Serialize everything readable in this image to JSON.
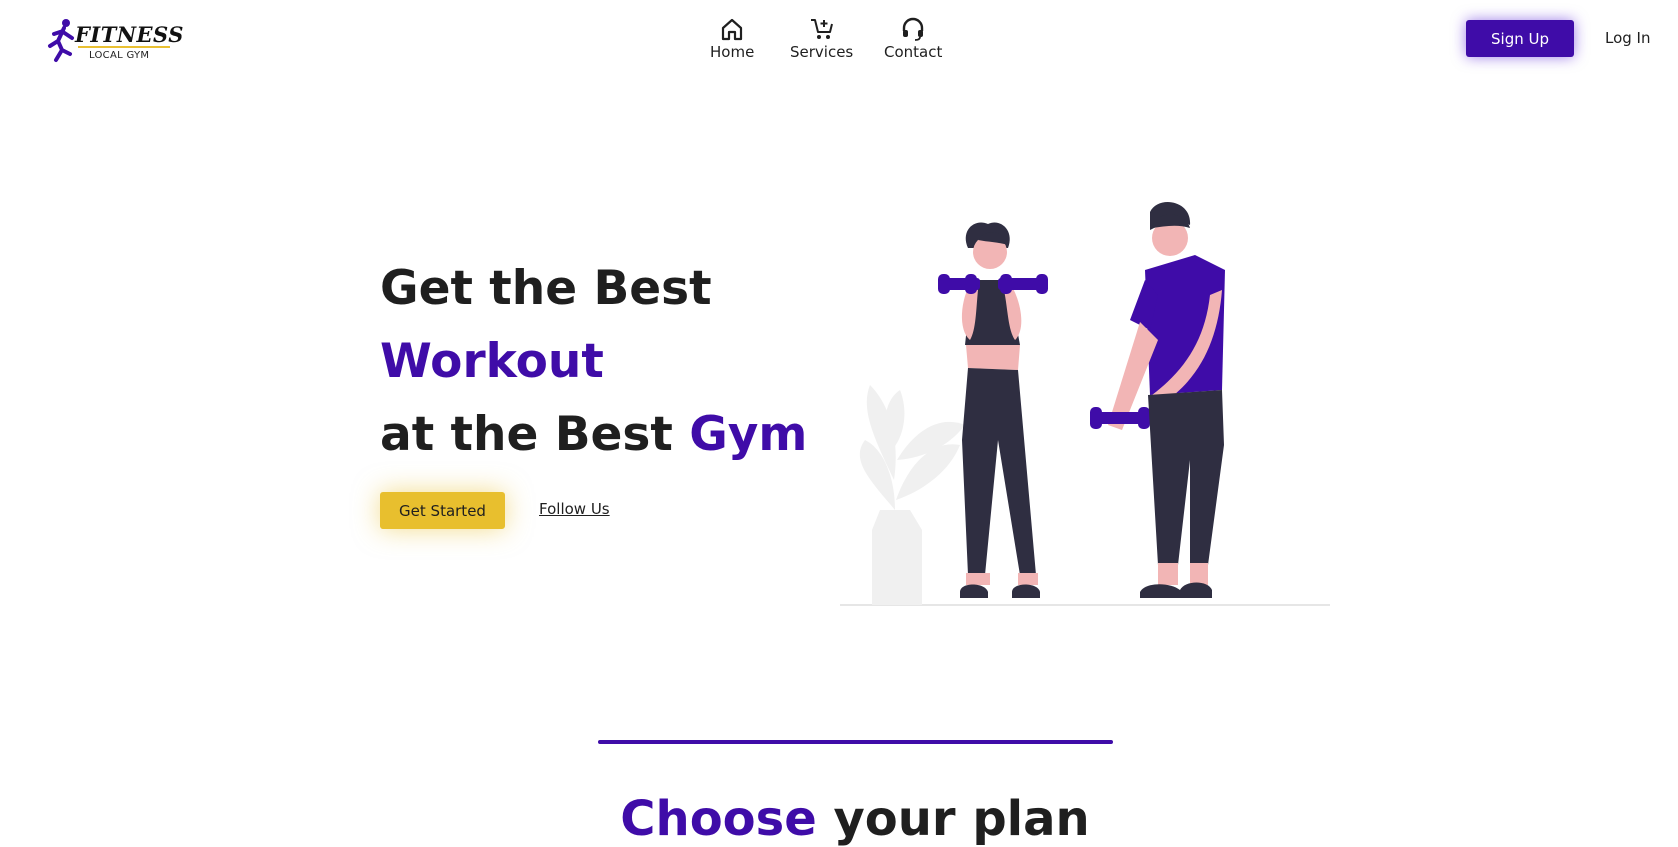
{
  "brand": {
    "name": "FITNESS",
    "tagline": "LOCAL GYM"
  },
  "nav": {
    "items": [
      {
        "label": "Home",
        "icon": "home-icon"
      },
      {
        "label": "Services",
        "icon": "cart-icon"
      },
      {
        "label": "Contact",
        "icon": "headset-icon"
      }
    ]
  },
  "auth": {
    "signup_label": "Sign Up",
    "login_label": "Log In"
  },
  "hero": {
    "line1": "Get the Best",
    "line2": "Workout",
    "line3_prefix": "at the Best ",
    "line3_accent": "Gym",
    "cta_primary": "Get Started",
    "cta_secondary": "Follow Us"
  },
  "plans": {
    "title_accent": "Choose",
    "title_rest": " your plan"
  },
  "colors": {
    "accent": "#3f0ca8",
    "cta_yellow": "#e8bf2e",
    "text": "#1f1f1f"
  }
}
